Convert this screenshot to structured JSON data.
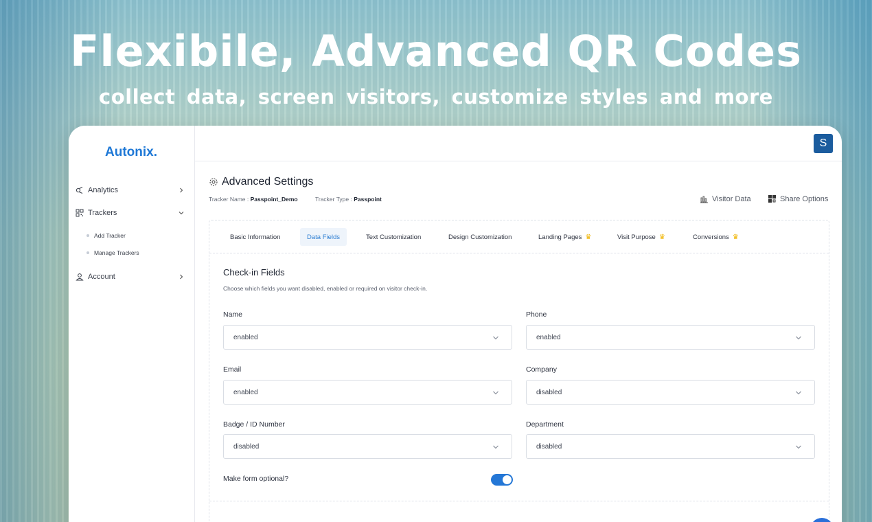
{
  "hero": {
    "title": "Flexibile, Advanced QR Codes",
    "subtitle": "collect data, screen visitors, customize styles and more"
  },
  "brand": {
    "name": "Autonix.",
    "accent": "#1e78d6"
  },
  "sidebar": {
    "items": [
      {
        "label": "Analytics",
        "icon": "analytics-icon"
      },
      {
        "label": "Trackers",
        "icon": "qr-icon",
        "expanded": true,
        "children": [
          {
            "label": "Add Tracker"
          },
          {
            "label": "Manage Trackers"
          }
        ]
      },
      {
        "label": "Account",
        "icon": "user-icon"
      }
    ]
  },
  "topbar": {
    "avatar_initial": "S",
    "avatar_color": "#1b5c9e"
  },
  "page": {
    "title": "Advanced Settings",
    "tracker_name_label": "Tracker Name :",
    "tracker_name": "Passpoint_Demo",
    "tracker_type_label": "Tracker Type :",
    "tracker_type": "Passpoint",
    "actions": {
      "visitor_data": "Visitor Data",
      "share_options": "Share Options"
    }
  },
  "tabs": [
    {
      "label": "Basic Information",
      "active": false
    },
    {
      "label": "Data Fields",
      "active": true
    },
    {
      "label": "Text Customization",
      "active": false
    },
    {
      "label": "Design Customization",
      "active": false
    },
    {
      "label": "Landing Pages",
      "premium": true
    },
    {
      "label": "Visit Purpose",
      "premium": true
    },
    {
      "label": "Conversions",
      "premium": true
    }
  ],
  "checkin": {
    "title": "Check-in Fields",
    "description": "Choose which fields you want disabled, enabled or required on visitor check-in.",
    "fields": [
      {
        "label": "Name",
        "value": "enabled"
      },
      {
        "label": "Phone",
        "value": "enabled"
      },
      {
        "label": "Email",
        "value": "enabled"
      },
      {
        "label": "Company",
        "value": "disabled"
      },
      {
        "label": "Badge / ID Number",
        "value": "disabled"
      },
      {
        "label": "Department",
        "value": "disabled"
      }
    ],
    "optional_label": "Make form optional?",
    "optional_enabled": true
  }
}
